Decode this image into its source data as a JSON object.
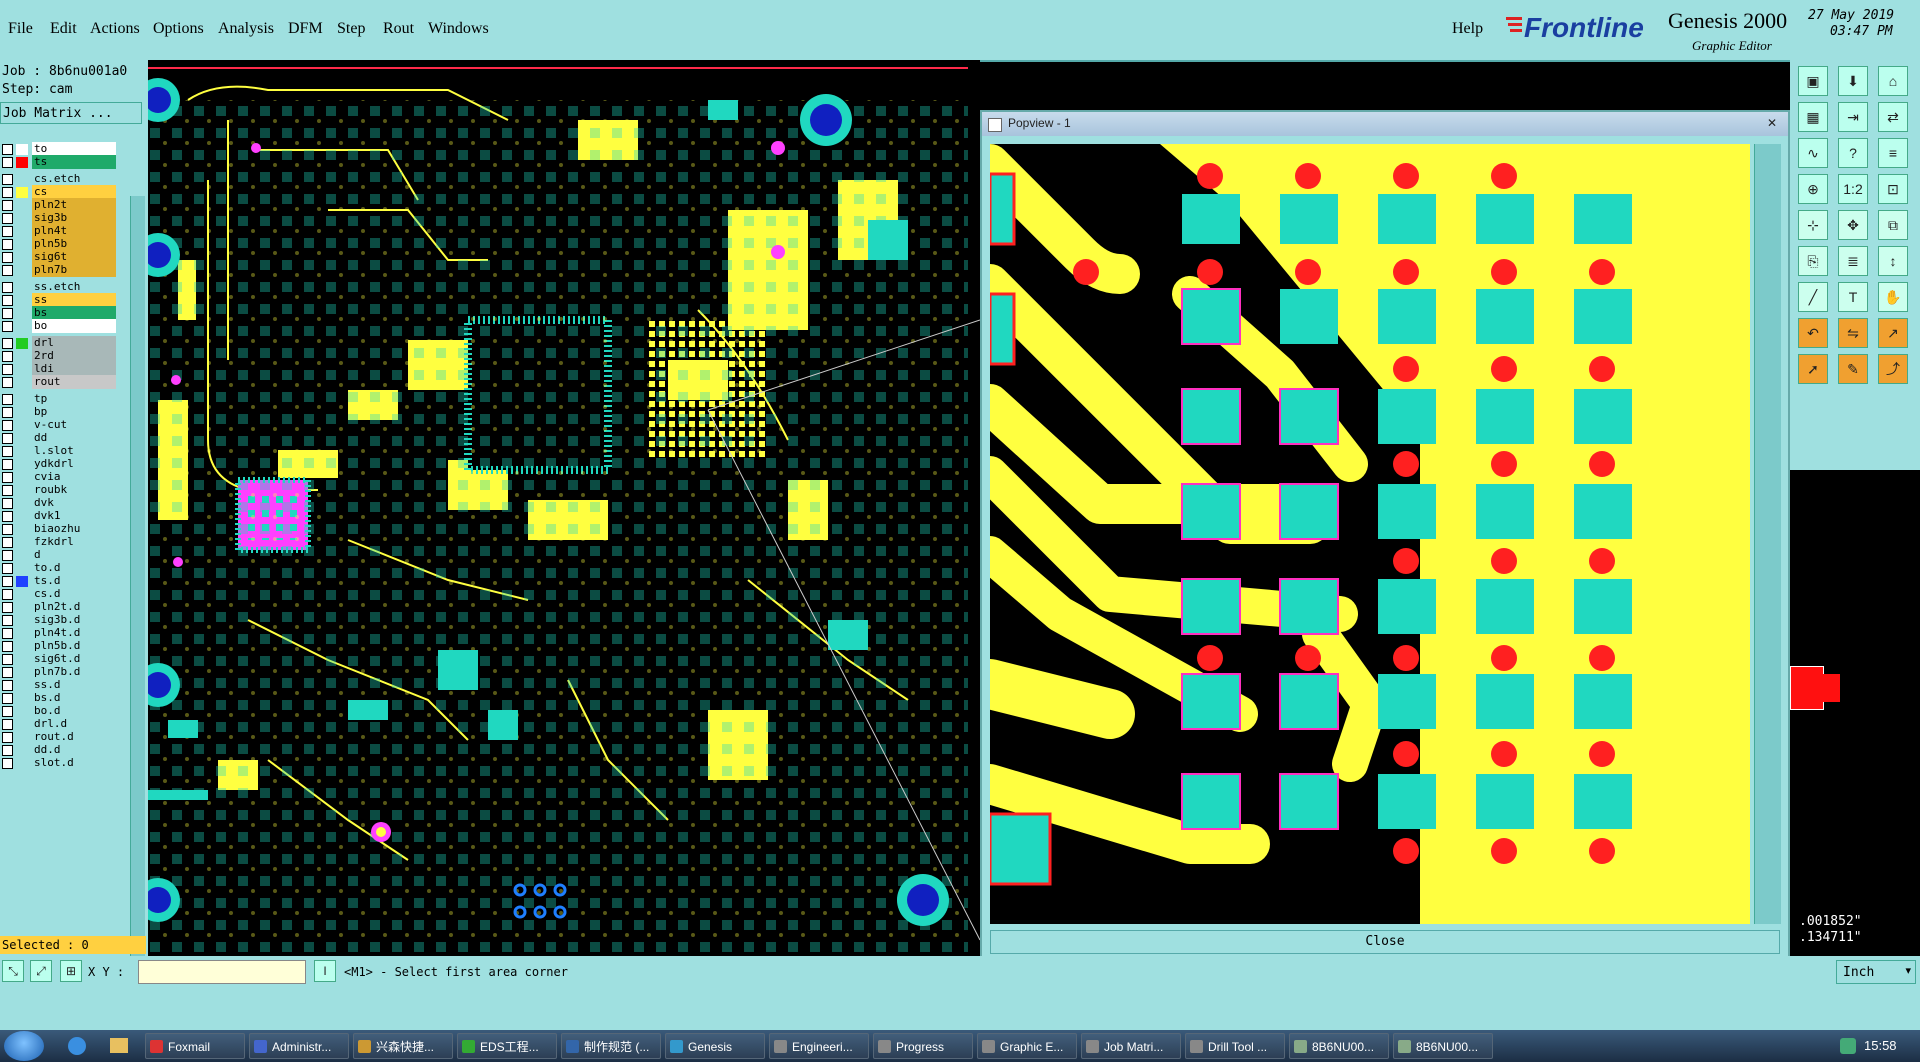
{
  "menu": {
    "items": [
      "File",
      "Edit",
      "Actions",
      "Options",
      "Analysis",
      "DFM",
      "Step",
      "Rout",
      "Windows"
    ],
    "help": "Help"
  },
  "brand": {
    "logo": "Frontline",
    "product": "Genesis 2000",
    "subtitle": "Graphic Editor",
    "date": "27 May 2019",
    "time": "03:47 PM"
  },
  "job": {
    "job_label": "Job : 8b6nu001a0",
    "step_label": "Step: cam",
    "matrix_button": "Job Matrix ..."
  },
  "layers": [
    {
      "name": "to",
      "sw": "#ffffff",
      "bg": "#ffffff",
      "sel": true
    },
    {
      "name": "ts",
      "sw": "#ff0000",
      "bg": "#1faa6a"
    },
    {
      "name": "cs.etch",
      "sw": "",
      "bg": "#9fe0e0"
    },
    {
      "name": "cs",
      "sw": "#ffff40",
      "bg": "#ffd040"
    },
    {
      "name": "pln2t",
      "sw": "",
      "bg": "#e0b030"
    },
    {
      "name": "sig3b",
      "sw": "",
      "bg": "#e0b030"
    },
    {
      "name": "pln4t",
      "sw": "",
      "bg": "#e0b030"
    },
    {
      "name": "pln5b",
      "sw": "",
      "bg": "#e0b030"
    },
    {
      "name": "sig6t",
      "sw": "",
      "bg": "#e0b030"
    },
    {
      "name": "pln7b",
      "sw": "",
      "bg": "#e0b030"
    },
    {
      "name": "ss.etch",
      "sw": "",
      "bg": "#9fe0e0"
    },
    {
      "name": "ss",
      "sw": "",
      "bg": "#ffd040"
    },
    {
      "name": "bs",
      "sw": "",
      "bg": "#1faa6a"
    },
    {
      "name": "bo",
      "sw": "",
      "bg": "#ffffff"
    },
    {
      "name": "drl",
      "sw": "#22cc22",
      "bg": "#a8b8b8"
    },
    {
      "name": "2rd",
      "sw": "",
      "bg": "#a8b8b8"
    },
    {
      "name": "ldi",
      "sw": "",
      "bg": "#a8b8b8"
    },
    {
      "name": "rout",
      "sw": "",
      "bg": "#c8c8c8"
    },
    {
      "name": "tp",
      "sw": "",
      "bg": "#9fe0e0"
    },
    {
      "name": "bp",
      "sw": "",
      "bg": "#9fe0e0"
    },
    {
      "name": "v-cut",
      "sw": "",
      "bg": "#9fe0e0"
    },
    {
      "name": "dd",
      "sw": "",
      "bg": "#9fe0e0"
    },
    {
      "name": "l.slot",
      "sw": "",
      "bg": "#9fe0e0"
    },
    {
      "name": "ydkdrl",
      "sw": "",
      "bg": "#9fe0e0"
    },
    {
      "name": "cvia",
      "sw": "",
      "bg": "#9fe0e0"
    },
    {
      "name": "roubk",
      "sw": "",
      "bg": "#9fe0e0"
    },
    {
      "name": "dvk",
      "sw": "",
      "bg": "#9fe0e0"
    },
    {
      "name": "dvk1",
      "sw": "",
      "bg": "#9fe0e0"
    },
    {
      "name": "biaozhu",
      "sw": "",
      "bg": "#9fe0e0"
    },
    {
      "name": "fzkdrl",
      "sw": "",
      "bg": "#9fe0e0"
    },
    {
      "name": "d",
      "sw": "",
      "bg": "#9fe0e0"
    },
    {
      "name": "to.d",
      "sw": "",
      "bg": "#9fe0e0"
    },
    {
      "name": "ts.d",
      "sw": "#2040ff",
      "bg": "#9fe0e0"
    },
    {
      "name": "cs.d",
      "sw": "",
      "bg": "#9fe0e0"
    },
    {
      "name": "pln2t.d",
      "sw": "",
      "bg": "#9fe0e0"
    },
    {
      "name": "sig3b.d",
      "sw": "",
      "bg": "#9fe0e0"
    },
    {
      "name": "pln4t.d",
      "sw": "",
      "bg": "#9fe0e0"
    },
    {
      "name": "pln5b.d",
      "sw": "",
      "bg": "#9fe0e0"
    },
    {
      "name": "sig6t.d",
      "sw": "",
      "bg": "#9fe0e0"
    },
    {
      "name": "pln7b.d",
      "sw": "",
      "bg": "#9fe0e0"
    },
    {
      "name": "ss.d",
      "sw": "",
      "bg": "#9fe0e0"
    },
    {
      "name": "bs.d",
      "sw": "",
      "bg": "#9fe0e0"
    },
    {
      "name": "bo.d",
      "sw": "",
      "bg": "#9fe0e0"
    },
    {
      "name": "drl.d",
      "sw": "",
      "bg": "#9fe0e0"
    },
    {
      "name": "rout.d",
      "sw": "",
      "bg": "#9fe0e0"
    },
    {
      "name": "dd.d",
      "sw": "",
      "bg": "#9fe0e0"
    },
    {
      "name": "slot.d",
      "sw": "",
      "bg": "#9fe0e0"
    }
  ],
  "selected": "Selected : 0",
  "status": {
    "xy_label": "X Y :",
    "xy_value": "",
    "prompt": "<M1> - Select first area corner",
    "units": "Inch"
  },
  "coords": {
    "x": ".001852\"",
    "y": ".134711\""
  },
  "popview": {
    "title": "Popview - 1",
    "close": "Close"
  },
  "toolbar_icons": [
    "window-icon",
    "download-icon",
    "home-icon",
    "grid-icon",
    "arrow-in-icon",
    "swap-icon",
    "curve-icon",
    "help-icon",
    "layers-icon",
    "zoom-icon",
    "scale-icon",
    "measure-icon",
    "snap-icon",
    "pan-icon",
    "copy-icon",
    "paste-icon",
    "align-icon",
    "move-icon",
    "draw-icon",
    "text-icon",
    "grab-icon",
    "undo-icon",
    "flip-icon",
    "arrow-icon",
    "pointer-icon",
    "edit-icon",
    "route-icon"
  ],
  "taskbar": {
    "items": [
      {
        "label": "Foxmail",
        "color": "#d33"
      },
      {
        "label": "Administr...",
        "color": "#46c"
      },
      {
        "label": "兴森快捷...",
        "color": "#c93"
      },
      {
        "label": "EDS工程...",
        "color": "#3a3"
      },
      {
        "label": "制作规范 (...",
        "color": "#36a"
      },
      {
        "label": "Genesis",
        "color": "#39c"
      },
      {
        "label": "Engineeri...",
        "color": "#888"
      },
      {
        "label": "Progress",
        "color": "#888"
      },
      {
        "label": "Graphic E...",
        "color": "#888"
      },
      {
        "label": "Job Matri...",
        "color": "#888"
      },
      {
        "label": "Drill Tool ...",
        "color": "#888"
      },
      {
        "label": "8B6NU00...",
        "color": "#8a8"
      },
      {
        "label": "8B6NU00...",
        "color": "#8a8"
      }
    ],
    "clock": "15:58"
  }
}
